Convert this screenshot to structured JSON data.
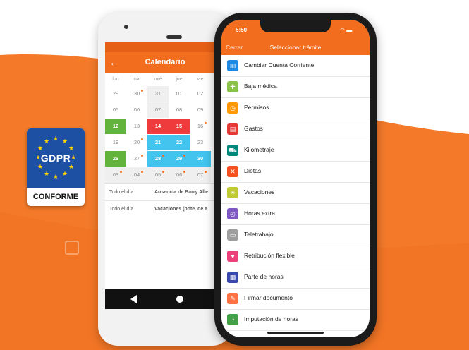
{
  "colors": {
    "brand_orange": "#f26e1e",
    "gdpr_blue": "#1d4fa3",
    "event_red": "#ef3b3b",
    "event_cyan": "#42c4ee",
    "event_green": "#61b33e"
  },
  "gdpr_badge": {
    "title": "GDPR",
    "label": "CONFORME"
  },
  "android": {
    "toolbar_title": "Calendario",
    "weekdays": [
      "lun",
      "mar",
      "mié",
      "jue",
      "vie"
    ],
    "weeks": [
      [
        "29",
        "30",
        "31",
        "01",
        "02"
      ],
      [
        "05",
        "06",
        "07",
        "08",
        "09"
      ],
      [
        "12",
        "13",
        "14",
        "15",
        "16"
      ],
      [
        "19",
        "20",
        "21",
        "22",
        "23"
      ],
      [
        "26",
        "27",
        "28",
        "29",
        "30"
      ],
      [
        "03",
        "04",
        "05",
        "06",
        "07"
      ]
    ],
    "events": [
      {
        "when": "Todo el día",
        "what": "Ausencia de Barry Alle"
      },
      {
        "when": "Todo el día",
        "what": "Vacaciones (pdte. de a"
      }
    ]
  },
  "iphone": {
    "time": "5:50",
    "cancel_label": "Cerrar",
    "title": "Seleccionar trámite",
    "items": [
      {
        "label": "Cambiar Cuenta Corriente",
        "icon": "bank-icon",
        "color": "#1e88e5",
        "glyph": "▥"
      },
      {
        "label": "Baja médica",
        "icon": "medical-icon",
        "color": "#8bc34a",
        "glyph": "✚"
      },
      {
        "label": "Permisos",
        "icon": "permissions-icon",
        "color": "#ff9800",
        "glyph": "◷"
      },
      {
        "label": "Gastos",
        "icon": "expenses-icon",
        "color": "#e53935",
        "glyph": "▤"
      },
      {
        "label": "Kilometraje",
        "icon": "car-icon",
        "color": "#00897b",
        "glyph": "⛟"
      },
      {
        "label": "Dietas",
        "icon": "food-icon",
        "color": "#f4511e",
        "glyph": "✕"
      },
      {
        "label": "Vacaciones",
        "icon": "vacation-icon",
        "color": "#c0ca33",
        "glyph": "☀"
      },
      {
        "label": "Horas extra",
        "icon": "clock-icon",
        "color": "#7e57c2",
        "glyph": "◴"
      },
      {
        "label": "Teletrabajo",
        "icon": "laptop-icon",
        "color": "#9e9e9e",
        "glyph": "▭"
      },
      {
        "label": "Retribución flexible",
        "icon": "flexible-pay-icon",
        "color": "#ec407a",
        "glyph": "♥"
      },
      {
        "label": "Parte de horas",
        "icon": "timesheet-icon",
        "color": "#3949ab",
        "glyph": "▦"
      },
      {
        "label": "Firmar documento",
        "icon": "sign-document-icon",
        "color": "#ff7043",
        "glyph": "✎"
      },
      {
        "label": "Imputación de horas",
        "icon": "time-allocation-icon",
        "color": "#43a047",
        "glyph": "◔"
      }
    ]
  }
}
